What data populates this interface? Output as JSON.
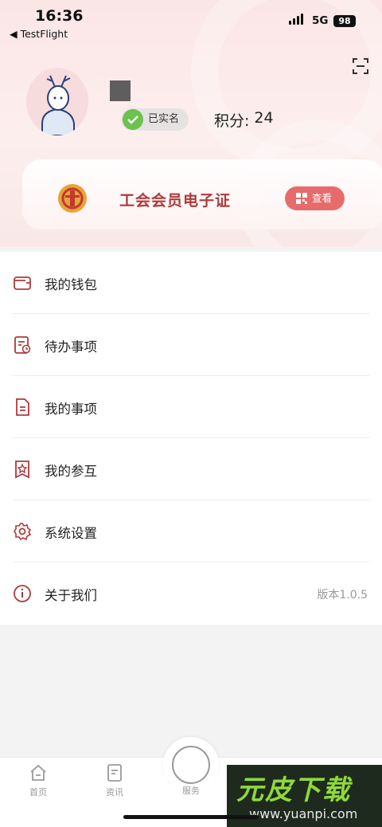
{
  "status_bar": {
    "time": "16:36",
    "back_app": "◀ TestFlight",
    "network": "5G",
    "battery": "98"
  },
  "profile": {
    "verified_label": "已实名",
    "points_label": "积分:",
    "points_value": "24"
  },
  "card": {
    "title": "工会会员电子证",
    "view_label": "查看"
  },
  "menu": {
    "items": [
      {
        "label": "我的钱包",
        "icon": "wallet-icon"
      },
      {
        "label": "待办事项",
        "icon": "todo-icon"
      },
      {
        "label": "我的事项",
        "icon": "document-icon"
      },
      {
        "label": "我的参互",
        "icon": "star-frame-icon"
      },
      {
        "label": "系统设置",
        "icon": "gear-icon"
      },
      {
        "label": "关于我们",
        "icon": "info-icon",
        "value": "版本1.0.5"
      }
    ]
  },
  "tab_bar": {
    "tabs": [
      "首页",
      "资讯",
      "服务"
    ]
  },
  "watermark": {
    "big": "元皮下载",
    "url": "www.yuanpi.com"
  },
  "colors": {
    "accent": "#b03a3a",
    "button": "#e86b6b",
    "verified": "#6cc14f",
    "header": "#fbe6e6"
  }
}
